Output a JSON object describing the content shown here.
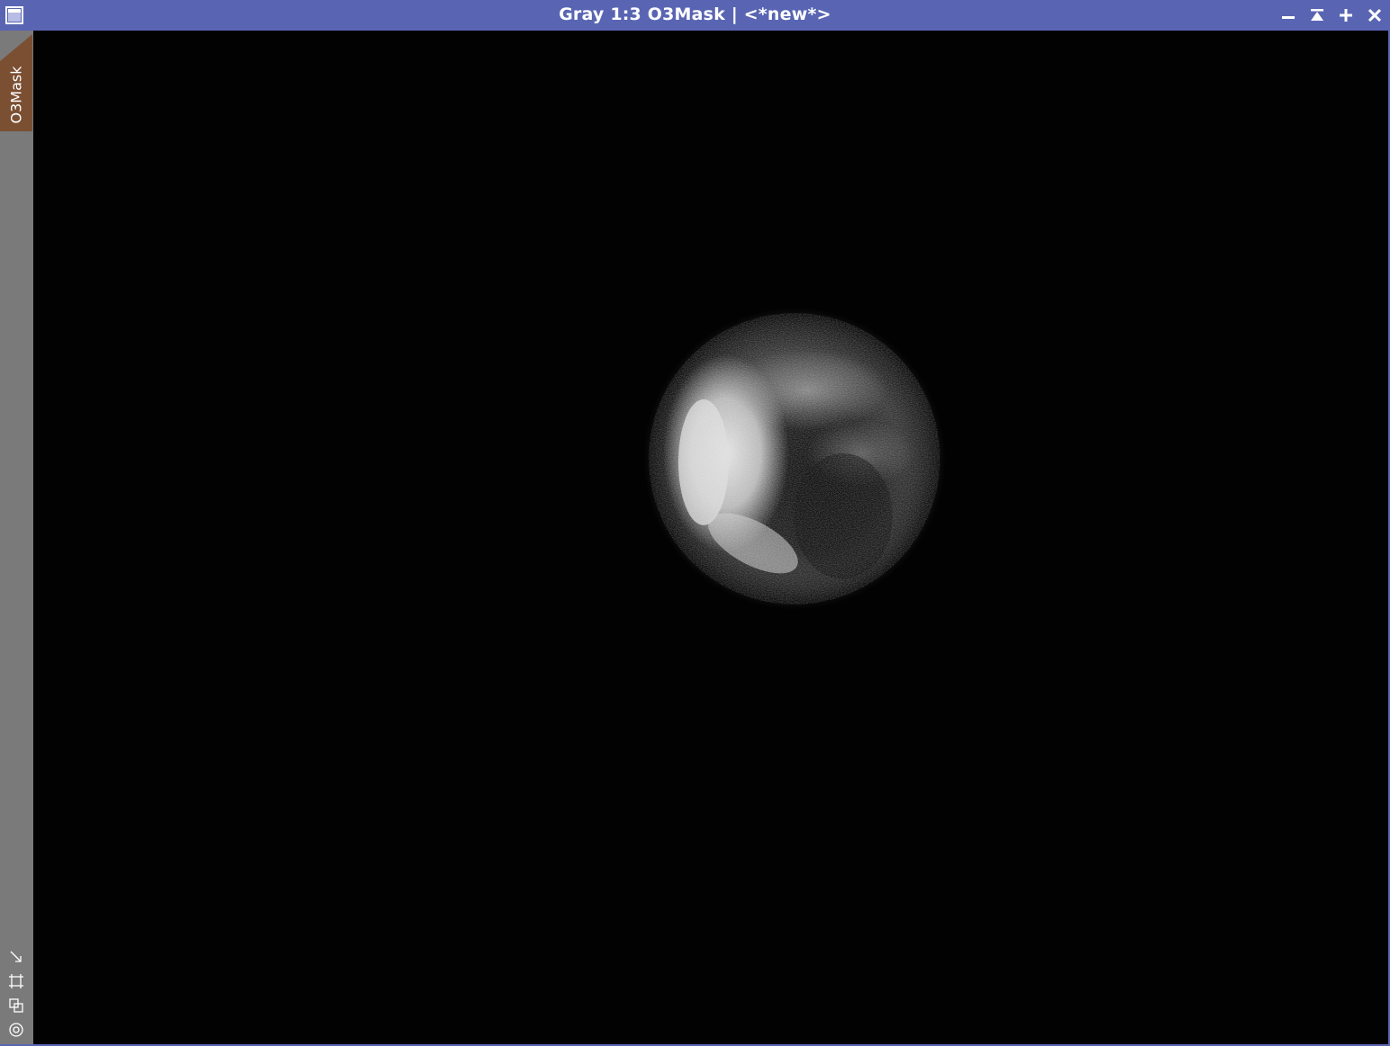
{
  "window": {
    "title": "Gray 1:3 O3Mask | <*new*>",
    "controls": {
      "minimize_icon": "minimize-icon",
      "shade_icon": "shade-icon",
      "maximize_icon": "plus-icon",
      "close_icon": "close-icon"
    }
  },
  "sidebar": {
    "tab_label": "O3Mask",
    "tools": [
      "fit-view-icon",
      "zoom-to-fit-icon",
      "clone-view-icon",
      "target-icon"
    ]
  },
  "colors": {
    "titlebar": "#5965b3",
    "tab": "#7b4f32",
    "sidebar": "#7a7a7a",
    "image_background": "#020202"
  }
}
